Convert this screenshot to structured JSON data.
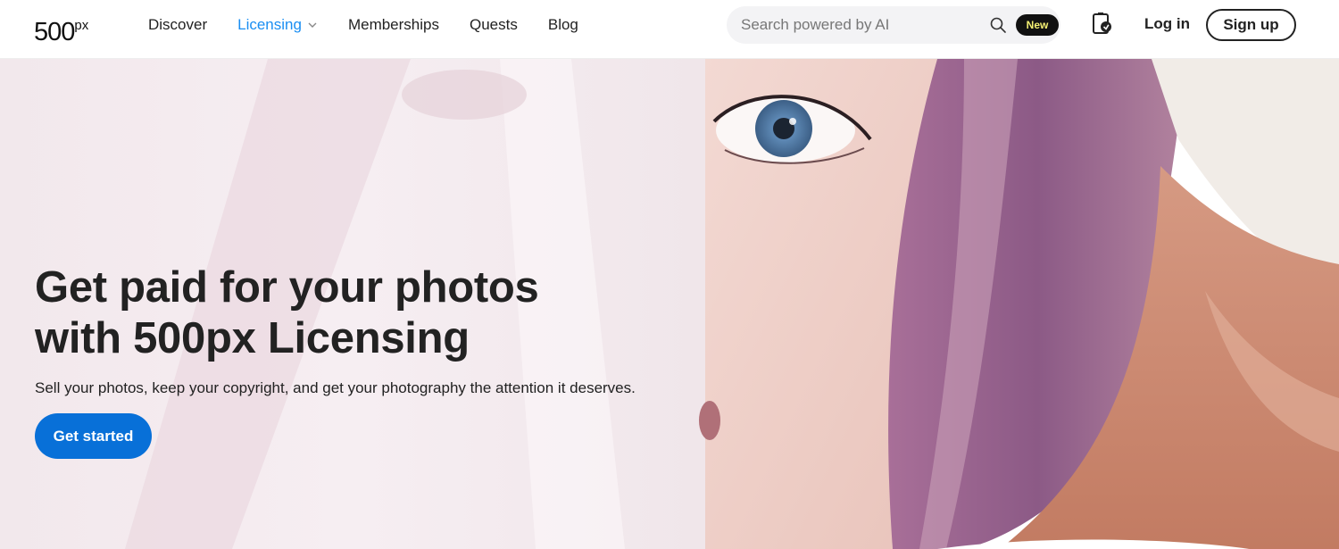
{
  "brand": {
    "logo_main": "500",
    "logo_sup": "px"
  },
  "nav": {
    "items": [
      {
        "label": "Discover"
      },
      {
        "label": "Licensing",
        "has_dropdown": true,
        "active": true
      },
      {
        "label": "Memberships"
      },
      {
        "label": "Quests"
      },
      {
        "label": "Blog"
      }
    ]
  },
  "search": {
    "placeholder": "Search powered by AI",
    "badge": "New"
  },
  "auth": {
    "login_label": "Log in",
    "signup_label": "Sign up"
  },
  "hero": {
    "title_line1": "Get paid for your photos",
    "title_line2": "with 500px Licensing",
    "subtitle": "Sell your photos, keep your copyright, and get your photography the attention it deserves.",
    "cta_label": "Get started"
  },
  "colors": {
    "accent": "#1a8ef2",
    "cta": "#0870d8",
    "badge_bg": "#111111",
    "badge_text": "#f5f073"
  },
  "icons": [
    "chevron-down-icon",
    "search-icon",
    "licensing-cart-icon"
  ]
}
